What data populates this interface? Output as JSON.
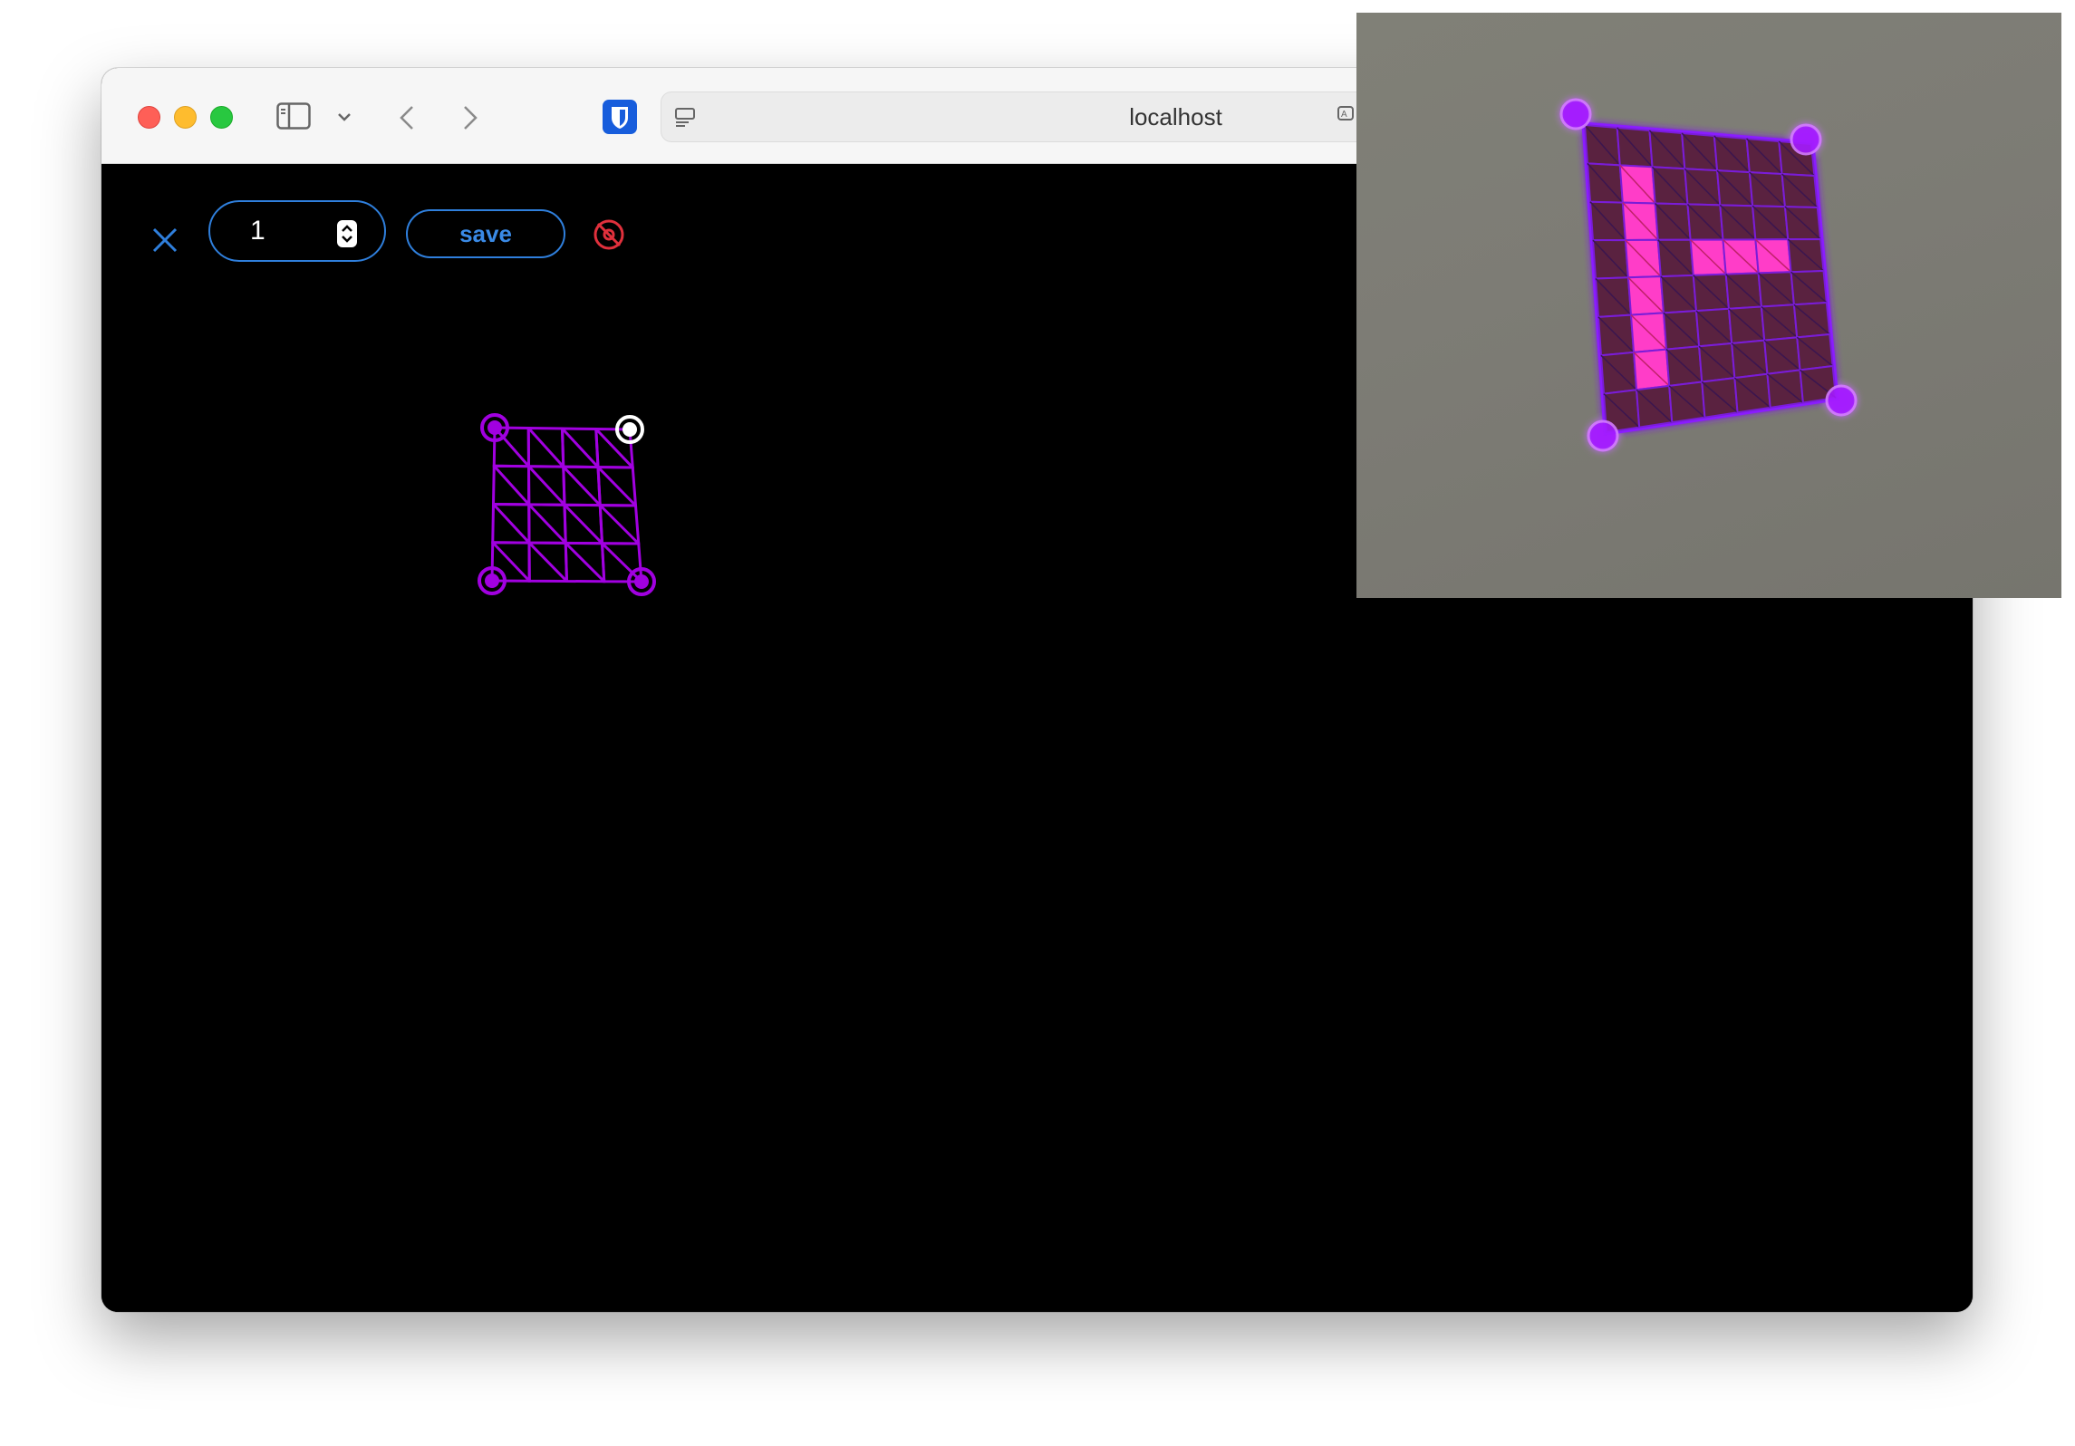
{
  "browser": {
    "address": "localhost",
    "icons": {
      "sidebar": "sidebar-toggle-icon",
      "chevron": "chevron-down-icon",
      "back": "back-arrow-icon",
      "forward": "forward-arrow-icon",
      "extension": "bitwarden-shield-icon",
      "page": "page-menu-icon",
      "translate": "translate-icon"
    }
  },
  "toolbar": {
    "close_icon": "close-icon",
    "number_value": "1",
    "save_label": "save",
    "visibility_icon": "eye-off-icon"
  },
  "colors": {
    "accent_blue": "#2f7fdc",
    "mesh_purple": "#a100e0",
    "warning_red": "#e0303c",
    "selected_handle": "#ffffff",
    "overlay_highlight": "#ff3cc8"
  },
  "mesh": {
    "rows": 4,
    "cols": 4,
    "selected_corner": "top-right"
  },
  "camera_preview": {
    "rows": 8,
    "cols": 7,
    "lit_cells": [
      [
        1,
        1
      ],
      [
        2,
        1
      ],
      [
        3,
        1
      ],
      [
        4,
        1
      ],
      [
        5,
        1
      ],
      [
        6,
        1
      ],
      [
        3,
        3
      ],
      [
        3,
        4
      ],
      [
        3,
        5
      ]
    ]
  }
}
